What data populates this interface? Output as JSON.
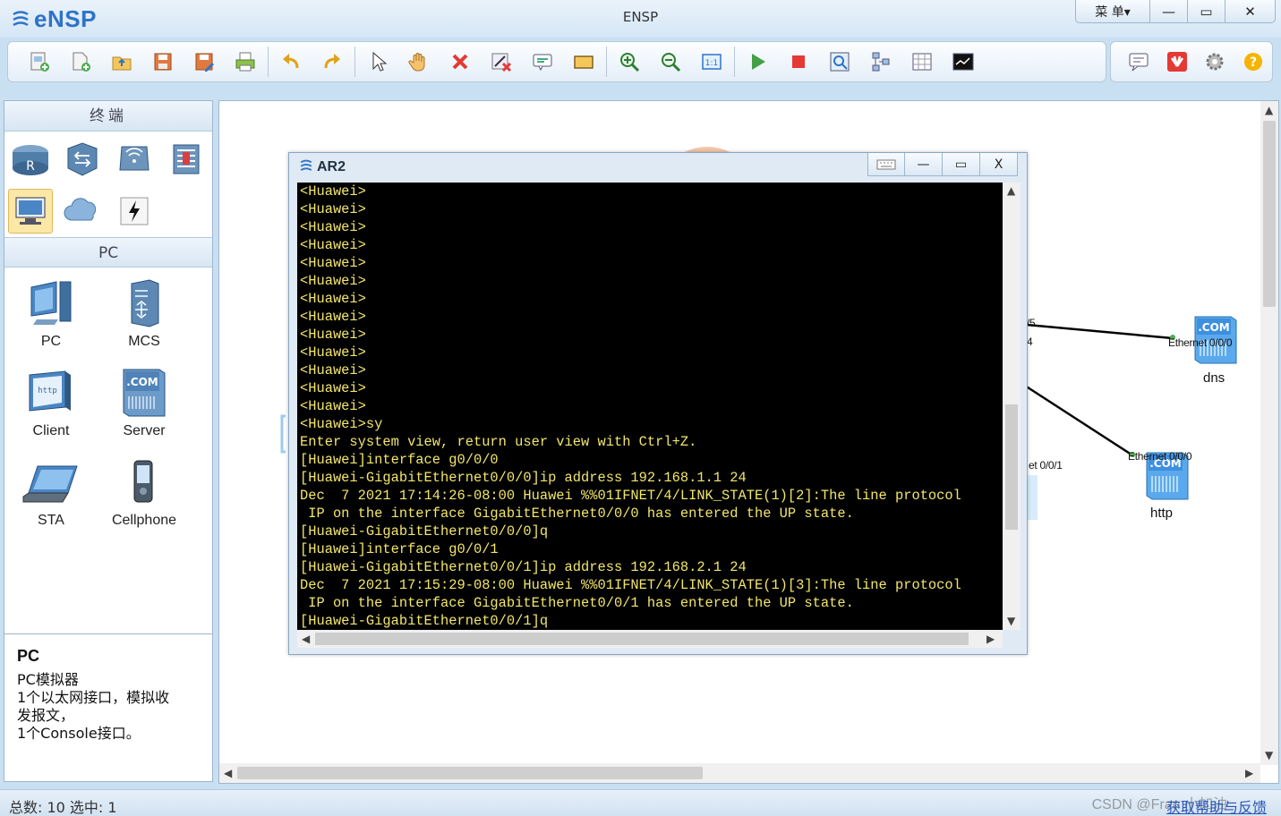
{
  "app": {
    "logo": "eNSP",
    "title": "ENSP",
    "menu_label": "菜 单▾",
    "min": "—",
    "max": "▭",
    "close": "✕"
  },
  "toolbar": {
    "icons": [
      "new-topology-icon",
      "new-file-icon",
      "open-icon",
      "save-icon",
      "save-as-icon",
      "print-icon",
      "undo-icon",
      "redo-icon",
      "select-icon",
      "hand-icon",
      "delete-icon",
      "delete-link-icon",
      "text-icon",
      "rectangle-icon",
      "zoom-in-icon",
      "zoom-out-icon",
      "fit-window-icon",
      "start-device-icon",
      "stop-device-icon",
      "capture-icon",
      "topology-icon",
      "grid-icon",
      "terminal-icon"
    ],
    "right_icons": [
      "chat-icon",
      "huawei-icon",
      "settings-icon",
      "help-icon"
    ]
  },
  "left_panel": {
    "category_title": "终端",
    "category_icons": [
      "router-icon",
      "switch-icon",
      "wlan-icon",
      "firewall-icon",
      "pc-terminal-icon",
      "cloud-icon",
      "lightning-icon"
    ],
    "sub_title": "PC",
    "devices": [
      {
        "label": "PC",
        "icon": "pc-icon"
      },
      {
        "label": "MCS",
        "icon": "mcs-icon"
      },
      {
        "label": "Client",
        "icon": "client-icon"
      },
      {
        "label": "Server",
        "icon": "server-icon"
      },
      {
        "label": "STA",
        "icon": "sta-icon"
      },
      {
        "label": "Cellphone",
        "icon": "cellphone-icon"
      }
    ]
  },
  "description": {
    "title": "PC",
    "lines": [
      "PC模拟器",
      "1个以太网接口，模拟收",
      "发报文，",
      "1个Console接口。"
    ]
  },
  "topology": {
    "nodes": [
      {
        "label": "dns",
        "port": "Ethernet 0/0/0"
      },
      {
        "label": "http",
        "port": "Ethernet 0/0/0"
      }
    ],
    "partial_labels": [
      "/5",
      "4",
      "et 0/0/1"
    ]
  },
  "terminal": {
    "title": "AR2",
    "lines": [
      "<Huawei>",
      "<Huawei>",
      "<Huawei>",
      "<Huawei>",
      "<Huawei>",
      "<Huawei>",
      "<Huawei>",
      "<Huawei>",
      "<Huawei>",
      "<Huawei>",
      "<Huawei>",
      "<Huawei>",
      "<Huawei>",
      "<Huawei>sy",
      "Enter system view, return user view with Ctrl+Z.",
      "[Huawei]interface g0/0/0",
      "[Huawei-GigabitEthernet0/0/0]ip address 192.168.1.1 24",
      "Dec  7 2021 17:14:26-08:00 Huawei %%01IFNET/4/LINK_STATE(1)[2]:The line protocol",
      " IP on the interface GigabitEthernet0/0/0 has entered the UP state.",
      "[Huawei-GigabitEthernet0/0/0]q",
      "[Huawei]interface g0/0/1",
      "[Huawei-GigabitEthernet0/0/1]ip address 192.168.2.1 24",
      "Dec  7 2021 17:15:29-08:00 Huawei %%01IFNET/4/LINK_STATE(1)[3]:The line protocol",
      " IP on the interface GigabitEthernet0/0/1 has entered the UP state.",
      "[Huawei-GigabitEthernet0/0/1]q"
    ]
  },
  "status": {
    "text": "总数: 10  选中: 1",
    "link": "获取帮助与反馈",
    "watermark": "CSDN @Fran 小加油"
  }
}
